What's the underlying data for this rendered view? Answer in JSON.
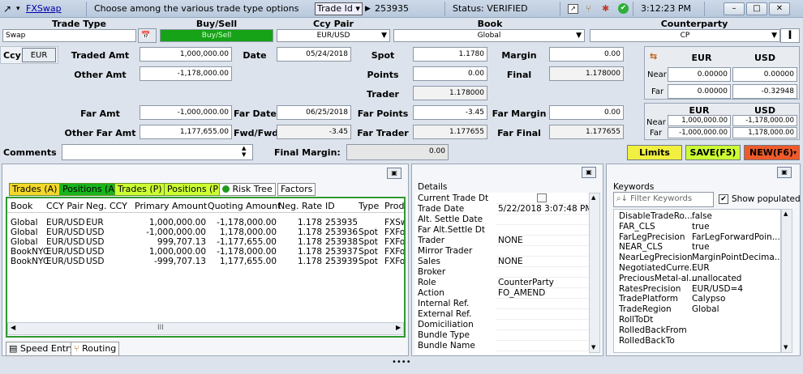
{
  "titlebar": {
    "app": "FXSwap",
    "hint": "Choose among the various trade type options",
    "trade_id_label": "Trade Id",
    "trade_id": "253935",
    "status": "Status: VERIFIED",
    "time": "3:12:23 PM"
  },
  "headers": {
    "trade_type": "Trade Type",
    "buy_sell": "Buy/Sell",
    "ccy_pair": "Ccy Pair",
    "book": "Book",
    "counterparty": "Counterparty"
  },
  "row1": {
    "trade_type": "Swap",
    "buy_sell": "Buy/Sell",
    "ccy_pair": "EUR/USD",
    "book": "Global",
    "counterparty": "CP"
  },
  "fields": {
    "ccy_label": "Ccy",
    "ccy_btn": "EUR",
    "traded_amt_label": "Traded Amt",
    "traded_amt": "1,000,000.00",
    "date_label": "Date",
    "date": "05/24/2018",
    "spot_label": "Spot",
    "spot": "1.1780",
    "margin_label": "Margin",
    "margin": "0.00",
    "other_amt_label": "Other Amt",
    "other_amt": "-1,178,000.00",
    "points_label": "Points",
    "points": "0.00",
    "final_label": "Final",
    "final": "1.178000",
    "trader_label": "Trader",
    "trader": "1.178000",
    "far_amt_label": "Far Amt",
    "far_amt": "-1,000,000.00",
    "far_date_label": "Far Date",
    "far_date": "06/25/2018",
    "far_points_label": "Far Points",
    "far_points": "-3.45",
    "far_margin_label": "Far Margin",
    "far_margin": "0.00",
    "other_far_amt_label": "Other Far Amt",
    "other_far_amt": "1,177,655.00",
    "fwd_fwd_label": "Fwd/Fwd",
    "fwd_fwd": "-3.45",
    "far_trader_label": "Far Trader",
    "far_trader": "1.177655",
    "far_final_label": "Far Final",
    "far_final": "1.177655",
    "comments_label": "Comments",
    "comments": "",
    "final_margin_label": "Final Margin:",
    "final_margin": "0.00"
  },
  "pl_box": {
    "col1": "EUR",
    "col2": "USD",
    "near_label": "Near",
    "near_eur": "0.00000",
    "near_usd": "0.00000",
    "far_label": "Far",
    "far_eur": "0.00000",
    "far_usd": "-0.32948"
  },
  "amt_box": {
    "col1": "EUR",
    "col2": "USD",
    "near_label": "Near",
    "near_eur": "1,000,000.00",
    "near_usd": "-1,178,000.00",
    "far_label": "Far",
    "far_eur": "-1,000,000.00",
    "far_usd": "1,178,000.00"
  },
  "actions": {
    "limits": "Limits",
    "save": "SAVE(F5)",
    "new": "NEW(F6)"
  },
  "tabs": [
    "Trades (A)",
    "Positions (A)",
    "Trades (P)",
    "Positions (P)",
    "Risk Tree",
    "Factors"
  ],
  "trades": {
    "columns": [
      "Book",
      "CCY Pair",
      "Neg. CCY",
      "Primary Amount",
      "Quoting Amount",
      "Neg. Rate",
      "ID",
      "Type",
      "Produ"
    ],
    "rows": [
      [
        "Global",
        "EUR/USD",
        "EUR",
        "1,000,000.00",
        "-1,178,000.00",
        "1.178",
        "253935",
        "",
        "FXSwa"
      ],
      [
        "Global",
        "EUR/USD",
        "USD",
        "-1,000,000.00",
        "1,178,000.00",
        "1.178",
        "253936",
        "Spot",
        "FXFor"
      ],
      [
        "Global",
        "EUR/USD",
        "USD",
        "999,707.13",
        "-1,177,655.00",
        "1.178",
        "253938",
        "Spot",
        "FXFor"
      ],
      [
        "BookNYC",
        "EUR/USD",
        "USD",
        "1,000,000.00",
        "-1,178,000.00",
        "1.178",
        "253937",
        "Spot",
        "FXFor"
      ],
      [
        "BookNYC",
        "EUR/USD",
        "USD",
        "-999,707.13",
        "1,177,655.00",
        "1.178",
        "253939",
        "Spot",
        "FXFor"
      ]
    ]
  },
  "bottom_tabs": {
    "speed_entry": "Speed Entry",
    "routing": "Routing"
  },
  "details": {
    "title": "Details",
    "rows": [
      [
        "Current Trade Dt",
        ""
      ],
      [
        "Trade Date",
        "5/22/2018 3:07:48 PM"
      ],
      [
        "Alt. Settle Date",
        ""
      ],
      [
        "Far Alt.Settle Dt",
        ""
      ],
      [
        "Trader",
        "NONE"
      ],
      [
        "Mirror Trader",
        ""
      ],
      [
        "Sales",
        "NONE"
      ],
      [
        "Broker",
        ""
      ],
      [
        "Role",
        "CounterParty"
      ],
      [
        "Action",
        "FO_AMEND"
      ],
      [
        "Internal Ref.",
        ""
      ],
      [
        "External Ref.",
        ""
      ],
      [
        "Domiciliation",
        ""
      ],
      [
        "Bundle Type",
        ""
      ],
      [
        "Bundle Name",
        ""
      ]
    ]
  },
  "keywords": {
    "title": "Keywords",
    "filter_placeholder": "Filter Keywords",
    "show_populated": "Show populated",
    "rows": [
      [
        "DisableTradeRo...",
        "false"
      ],
      [
        "FAR_CLS",
        "true"
      ],
      [
        "FarLegPrecision",
        "FarLegForwardPoin..."
      ],
      [
        "NEAR_CLS",
        "true"
      ],
      [
        "NearLegPrecision",
        "MarginPointDecima..."
      ],
      [
        "NegotiatedCurre...",
        "EUR"
      ],
      [
        "PreciousMetal-al...",
        "unallocated"
      ],
      [
        "RatesPrecision",
        "EUR/USD=4"
      ],
      [
        "TradePlatform",
        "Calypso"
      ],
      [
        "TradeRegion",
        "Global"
      ],
      [
        "RollToDt",
        ""
      ],
      [
        "RolledBackFrom",
        ""
      ],
      [
        "RolledBackTo",
        ""
      ]
    ]
  },
  "colors": {
    "green": "#17a317",
    "lime": "#ccff33",
    "yellow": "#f1f040",
    "red": "#ef5a2a"
  }
}
